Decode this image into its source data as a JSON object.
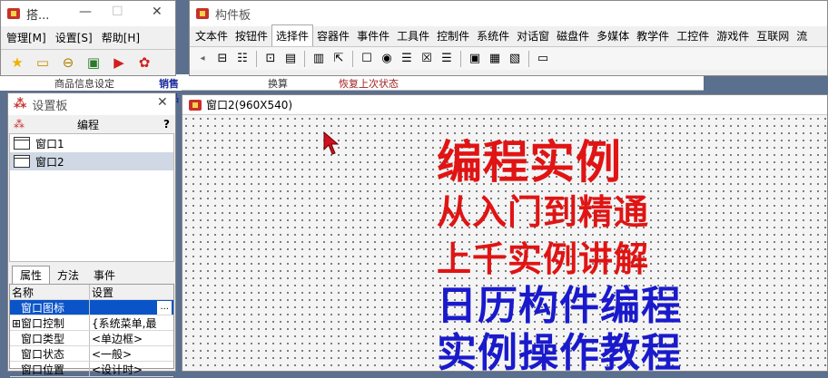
{
  "toolwin": {
    "title": "搭...",
    "menu": [
      "管理[M]",
      "设置[S]",
      "帮助[H]"
    ]
  },
  "board": {
    "title": "构件板",
    "tabs": [
      "文本件",
      "按钮件",
      "选择件",
      "容器件",
      "事件件",
      "工具件",
      "控制件",
      "系统件",
      "对话窗",
      "磁盘件",
      "多媒体",
      "教学件",
      "工控件",
      "游戏件",
      "互联网",
      "流"
    ],
    "selected_tab": 2
  },
  "behind": {
    "t1": "商品信息设定",
    "t2": "销售商品",
    "t3": "换算",
    "t4": "恢复上次状态"
  },
  "settings": {
    "title": "设置板",
    "header_label": "编程",
    "help": "?",
    "tree": [
      "窗口1",
      "窗口2"
    ],
    "tree_selected": 1,
    "tabs": [
      "属性",
      "方法",
      "事件"
    ],
    "grid_header": [
      "名称",
      "设置"
    ],
    "rows": [
      {
        "name": "窗口图标",
        "value": "",
        "selected": true,
        "ellipsis": "..."
      },
      {
        "name": "⊞窗口控制",
        "value": "{系统菜单,最"
      },
      {
        "name": "窗口类型",
        "value": "<单边框>"
      },
      {
        "name": "窗口状态",
        "value": "<一般>"
      },
      {
        "name": "窗口位置",
        "value": "<设计时>"
      }
    ]
  },
  "design": {
    "title": "窗口2(960X540)",
    "lines": [
      "编程实例",
      "从入门到精通",
      "上千实例讲解",
      "日历构件编程",
      "实例操作教程"
    ],
    "colors": {
      "red": "#e01414",
      "blue": "#1a1acc"
    }
  }
}
